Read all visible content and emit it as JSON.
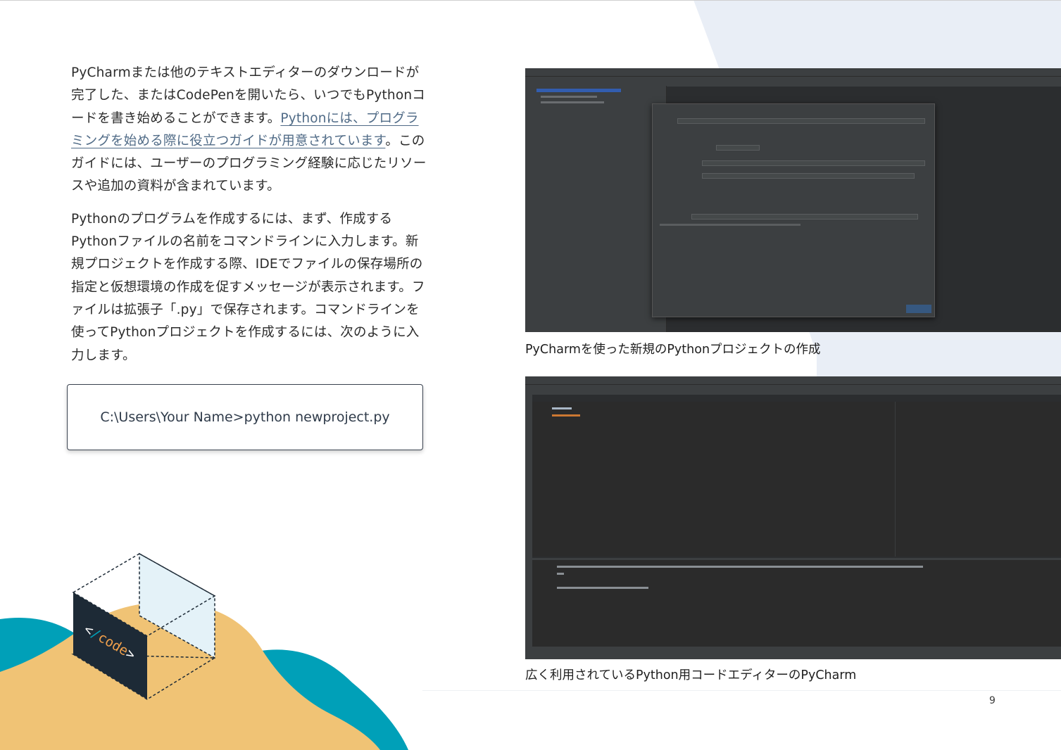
{
  "body": {
    "para1_part1": "PyCharmまたは他のテキストエディターのダウンロードが完了した、またはCodePenを開いたら、いつでもPythonコードを書き始めることができます。",
    "para1_link": "Pythonには、プログラミングを始める際に役立つガイドが用意されています",
    "para1_part2": "。このガイドには、ユーザーのプログラミング経験に応じたリソースや追加の資料が含まれています。",
    "para2": "Pythonのプログラムを作成するには、まず、作成するPythonファイルの名前をコマンドラインに入力します。新規プロジェクトを作成する際、IDEでファイルの保存場所の指定と仮想環境の作成を促すメッセージが表示されます。ファイルは拡張子「.py」で保存されます。コマンドラインを使ってPythonプロジェクトを作成するには、次のように入力します。"
  },
  "code_example": "C:\\Users\\Your Name>python newproject.py",
  "figures": [
    {
      "caption": "PyCharmを使った新規のPythonプロジェクトの作成"
    },
    {
      "caption": "広く利用されているPython用コードエディターのPyCharm"
    }
  ],
  "illustration": {
    "label": "code"
  },
  "page_number": "9",
  "colors": {
    "teal": "#00a0b8",
    "sand": "#f0c375",
    "navy": "#1d2a36",
    "pale_blue": "#e4eef6",
    "link": "#4f6a86"
  }
}
